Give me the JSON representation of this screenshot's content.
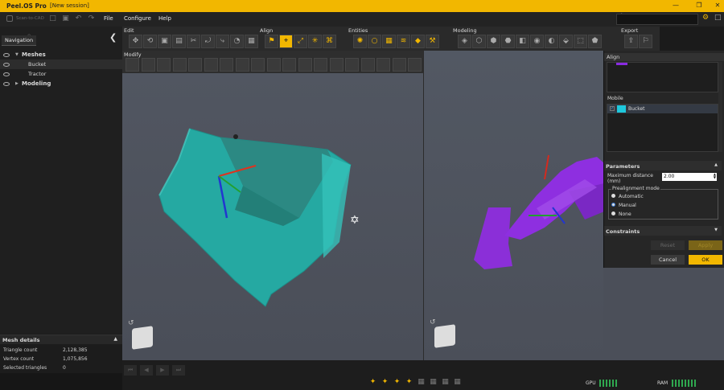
{
  "titlebar": {
    "app_name": "Peel.OS Pro",
    "session": "[New session]"
  },
  "menubar": {
    "scan_label": "Scan-to-CAD",
    "items": [
      "File",
      "Configure",
      "Help"
    ]
  },
  "navigation": {
    "tab": "Navigation",
    "tree": [
      {
        "label": "Meshes",
        "level": 0,
        "bold": true
      },
      {
        "label": "Bucket",
        "level": 1,
        "selected": true
      },
      {
        "label": "Tractor",
        "level": 1
      },
      {
        "label": "Modeling",
        "level": 0,
        "bold": true
      }
    ]
  },
  "toolbar": {
    "groups": [
      "Edit",
      "Align",
      "Entities",
      "Modeling",
      "Export"
    ],
    "modify_label": "Modify"
  },
  "mesh_details": {
    "title": "Mesh details",
    "rows": [
      {
        "label": "Triangle count",
        "value": "2,128,385"
      },
      {
        "label": "Vertex count",
        "value": "1,075,856"
      },
      {
        "label": "Selected triangles",
        "value": "0"
      }
    ]
  },
  "align_panel": {
    "title": "Align",
    "mobile_label": "Mobile",
    "mobile_item": "Bucket",
    "parameters_label": "Parameters",
    "max_distance_label": "Maximum distance (mm)",
    "max_distance_value": "2.00",
    "prealignment_label": "Prealignment mode",
    "modes": [
      "Automatic",
      "Manual",
      "None"
    ],
    "selected_mode": "Manual",
    "constraints_label": "Constraints",
    "reset_label": "Reset",
    "apply_label": "Apply",
    "cancel_label": "Cancel",
    "ok_label": "OK"
  },
  "status": {
    "gpu_label": "GPU",
    "ram_label": "RAM"
  },
  "colors": {
    "accent": "#f2b700",
    "bucket": "#2bb5aa",
    "tractor": "#8a2be2",
    "mobile_swatch": "#1ec8dc"
  }
}
